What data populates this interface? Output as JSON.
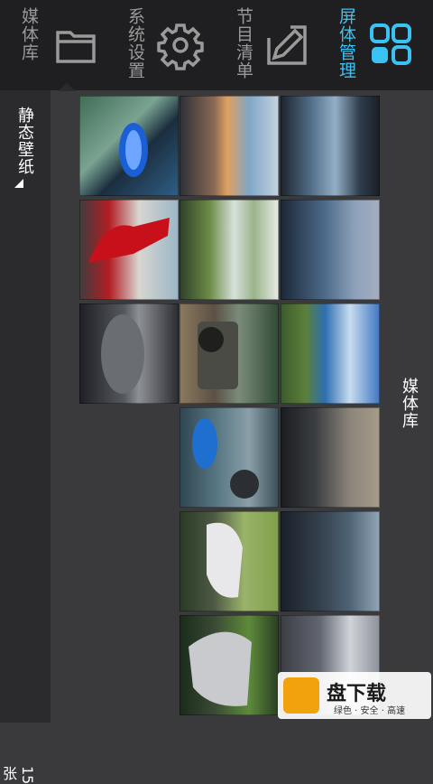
{
  "tabs": [
    {
      "label": "媒体库",
      "icon": "folder-icon"
    },
    {
      "label": "系统设置",
      "icon": "gear-icon"
    },
    {
      "label": "节目清单",
      "icon": "edit-icon"
    },
    {
      "label": "屏体管理",
      "icon": "grid-icon"
    }
  ],
  "colors": {
    "accent": "#39c2f2",
    "bar": "#1f1f21",
    "panel": "#2b2b2d"
  },
  "left_panel": {
    "category": "静态壁纸",
    "count": "15张"
  },
  "right_panel": {
    "title": "媒体库"
  },
  "thumbnails": [
    {
      "name": "blue sports car"
    },
    {
      "name": "sunset over water"
    },
    {
      "name": "frozen lake"
    },
    {
      "name": "red supercar with open doors"
    },
    {
      "name": "green lakeshore with trees"
    },
    {
      "name": "pier at dusk"
    },
    {
      "name": "grey sports car"
    },
    {
      "name": "off-road jeep"
    },
    {
      "name": "blue sky with grass"
    },
    {
      "name": "blue car on road"
    },
    {
      "name": "rain drops on glass"
    },
    {
      "name": "white supercar on grass"
    },
    {
      "name": "calm dark lake"
    },
    {
      "name": "white sports car front"
    },
    {
      "name": "white car on road"
    }
  ],
  "watermark": {
    "text": "盘下载",
    "sub": "绿色 · 安全 · 高速",
    "logo": "快"
  }
}
